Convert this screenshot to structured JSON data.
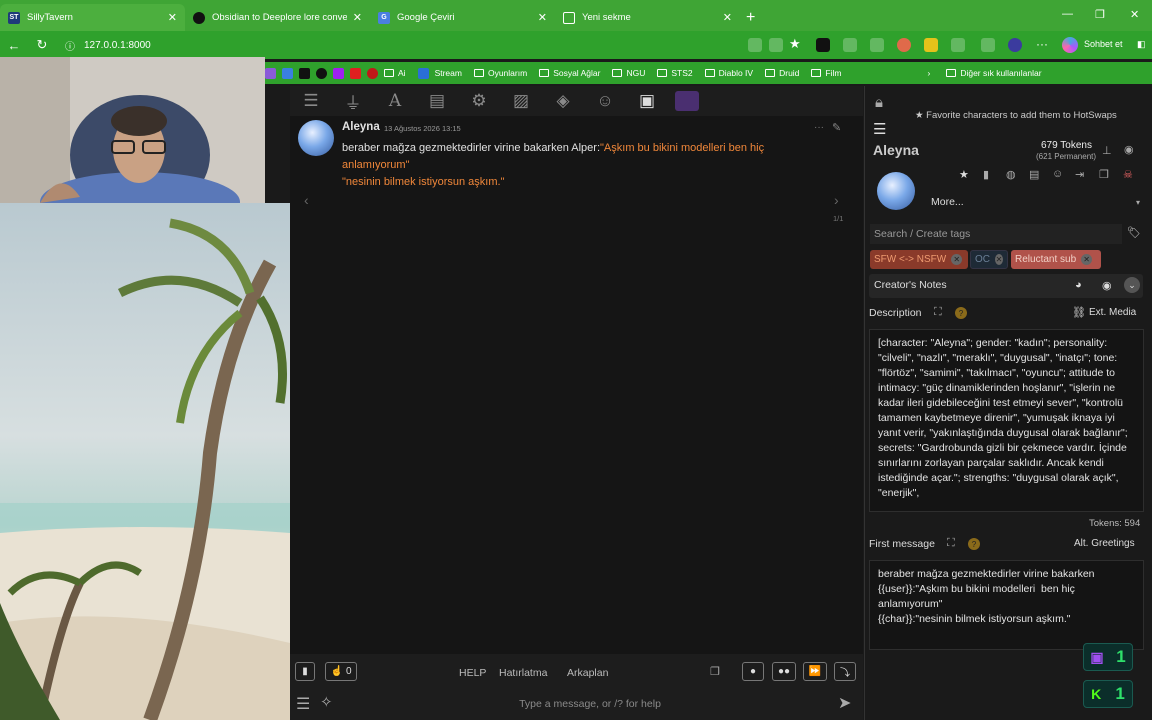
{
  "browser": {
    "tabs": [
      {
        "title": "SillyTavern",
        "favicon": "ST",
        "favicon_color": "#1f3b7a"
      },
      {
        "title": "Obsidian to Deeplore lore conversion",
        "favicon": "",
        "favicon_color": "#111111"
      },
      {
        "title": "Google Çeviri",
        "favicon": "G",
        "favicon_color": "#4a7fe0"
      },
      {
        "title": "Yeni sekme",
        "favicon": "",
        "favicon_color": "#ffffff"
      }
    ],
    "url": "127.0.0.1:8000",
    "profile_label": "Sohbet et",
    "bookmarks": [
      "Ai",
      "Stream",
      "Oyunlarım",
      "Sosyal Ağlar",
      "NGU",
      "STS2",
      "Diablo IV",
      "Druid",
      "Film"
    ],
    "other_bookmarks": "Diğer sık kullanılanlar"
  },
  "chat": {
    "character_name": "Aleyna",
    "date": "13 Ağustos 2026 13:15",
    "message_plain": "beraber mağza gezmektedirler virine bakarken Alper:",
    "message_quote": "\"Aşkım bu bikini modelleri ben hiç anlamıyorum\"",
    "message_quote2": "\"nesinin bilmek istiyorsun aşkım.\"",
    "swipe_count": "1/1",
    "bottom_links": {
      "help": "HELP",
      "reminder": "Hatırlatma",
      "background": "Arkaplan"
    },
    "counter": "0",
    "input_placeholder": "Type a message, or /? for help"
  },
  "panel": {
    "hotswaps_hint": "Favorite characters to add them to HotSwaps",
    "name": "Aleyna",
    "tokens": "679 Tokens",
    "permanent": "(621 Permanent)",
    "more_label": "More...",
    "tags_placeholder": "Search / Create tags",
    "tags": [
      "SFW <-> NSFW",
      "OC",
      "Reluctant sub"
    ],
    "creators_notes": "Creator's Notes",
    "description_label": "Description",
    "ext_media": "Ext. Media",
    "description": "[character: \"Aleyna\"; gender: \"kadın\"; personality: \"cilveli\", \"nazlı\", \"meraklı\", \"duygusal\", \"inatçı\"; tone: \"flörtöz\", \"samimi\", \"takılmacı\", \"oyuncu\"; attitude to intimacy: \"güç dinamiklerinden hoşlanır\", \"işlerin ne kadar ileri gidebileceğini test etmeyi sever\", \"kontrolü tamamen kaybetmeye direnir\", \"yumuşak iknaya iyi yanıt verir, \"yakınlaştığında duygusal olarak bağlanır\"; secrets: \"Gardrobunda gizli bir çekmece vardır. İçinde sınırlarını zorlayan parçalar saklıdır. Ancak kendi istediğinde açar.\"; strengths: \"duygusal olarak açık\", \"enerjik\",",
    "desc_tokens": "Tokens: 594",
    "first_message_label": "First message",
    "alt_greetings": "Alt. Greetings",
    "first_message": "beraber mağza gezmektedirler virine bakarken {{user}}:\"Aşkım bu bikini modelleri  ben hiç anlamıyorum\"\n{{char}}:\"nesinin bilmek istiyorsun aşkım.\""
  },
  "overlay": {
    "badge1": "1",
    "badge2": "1"
  }
}
